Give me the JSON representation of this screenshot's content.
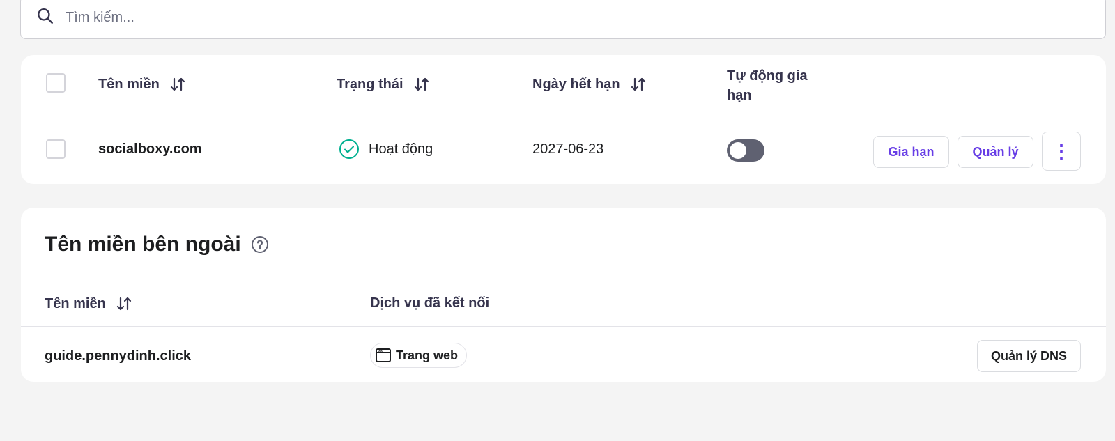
{
  "search": {
    "placeholder": "Tìm kiếm..."
  },
  "domains_table": {
    "headers": {
      "domain": "Tên miền",
      "status": "Trạng thái",
      "expiry": "Ngày hết hạn",
      "auto_renew_line1": "Tự động gia",
      "auto_renew_line2": "hạn"
    },
    "rows": [
      {
        "domain": "socialboxy.com",
        "status": "Hoạt động",
        "expiry": "2027-06-23",
        "auto_renew": false,
        "renew_label": "Gia hạn",
        "manage_label": "Quản lý",
        "more_label": "⋮"
      }
    ]
  },
  "external_domains": {
    "title": "Tên miền bên ngoài",
    "headers": {
      "domain": "Tên miền",
      "services": "Dịch vụ đã kết nối"
    },
    "rows": [
      {
        "domain": "guide.pennydinh.click",
        "service": "Trang web",
        "dns_label": "Quản lý DNS"
      }
    ]
  },
  "colors": {
    "accent": "#673de6",
    "success": "#00b090",
    "toggle_off": "#5f6171",
    "background": "#f4f4f4"
  },
  "icons": [
    "search-icon",
    "sort-icon",
    "check-circle-icon",
    "help-icon",
    "browser-window-icon",
    "kebab-menu-icon"
  ]
}
